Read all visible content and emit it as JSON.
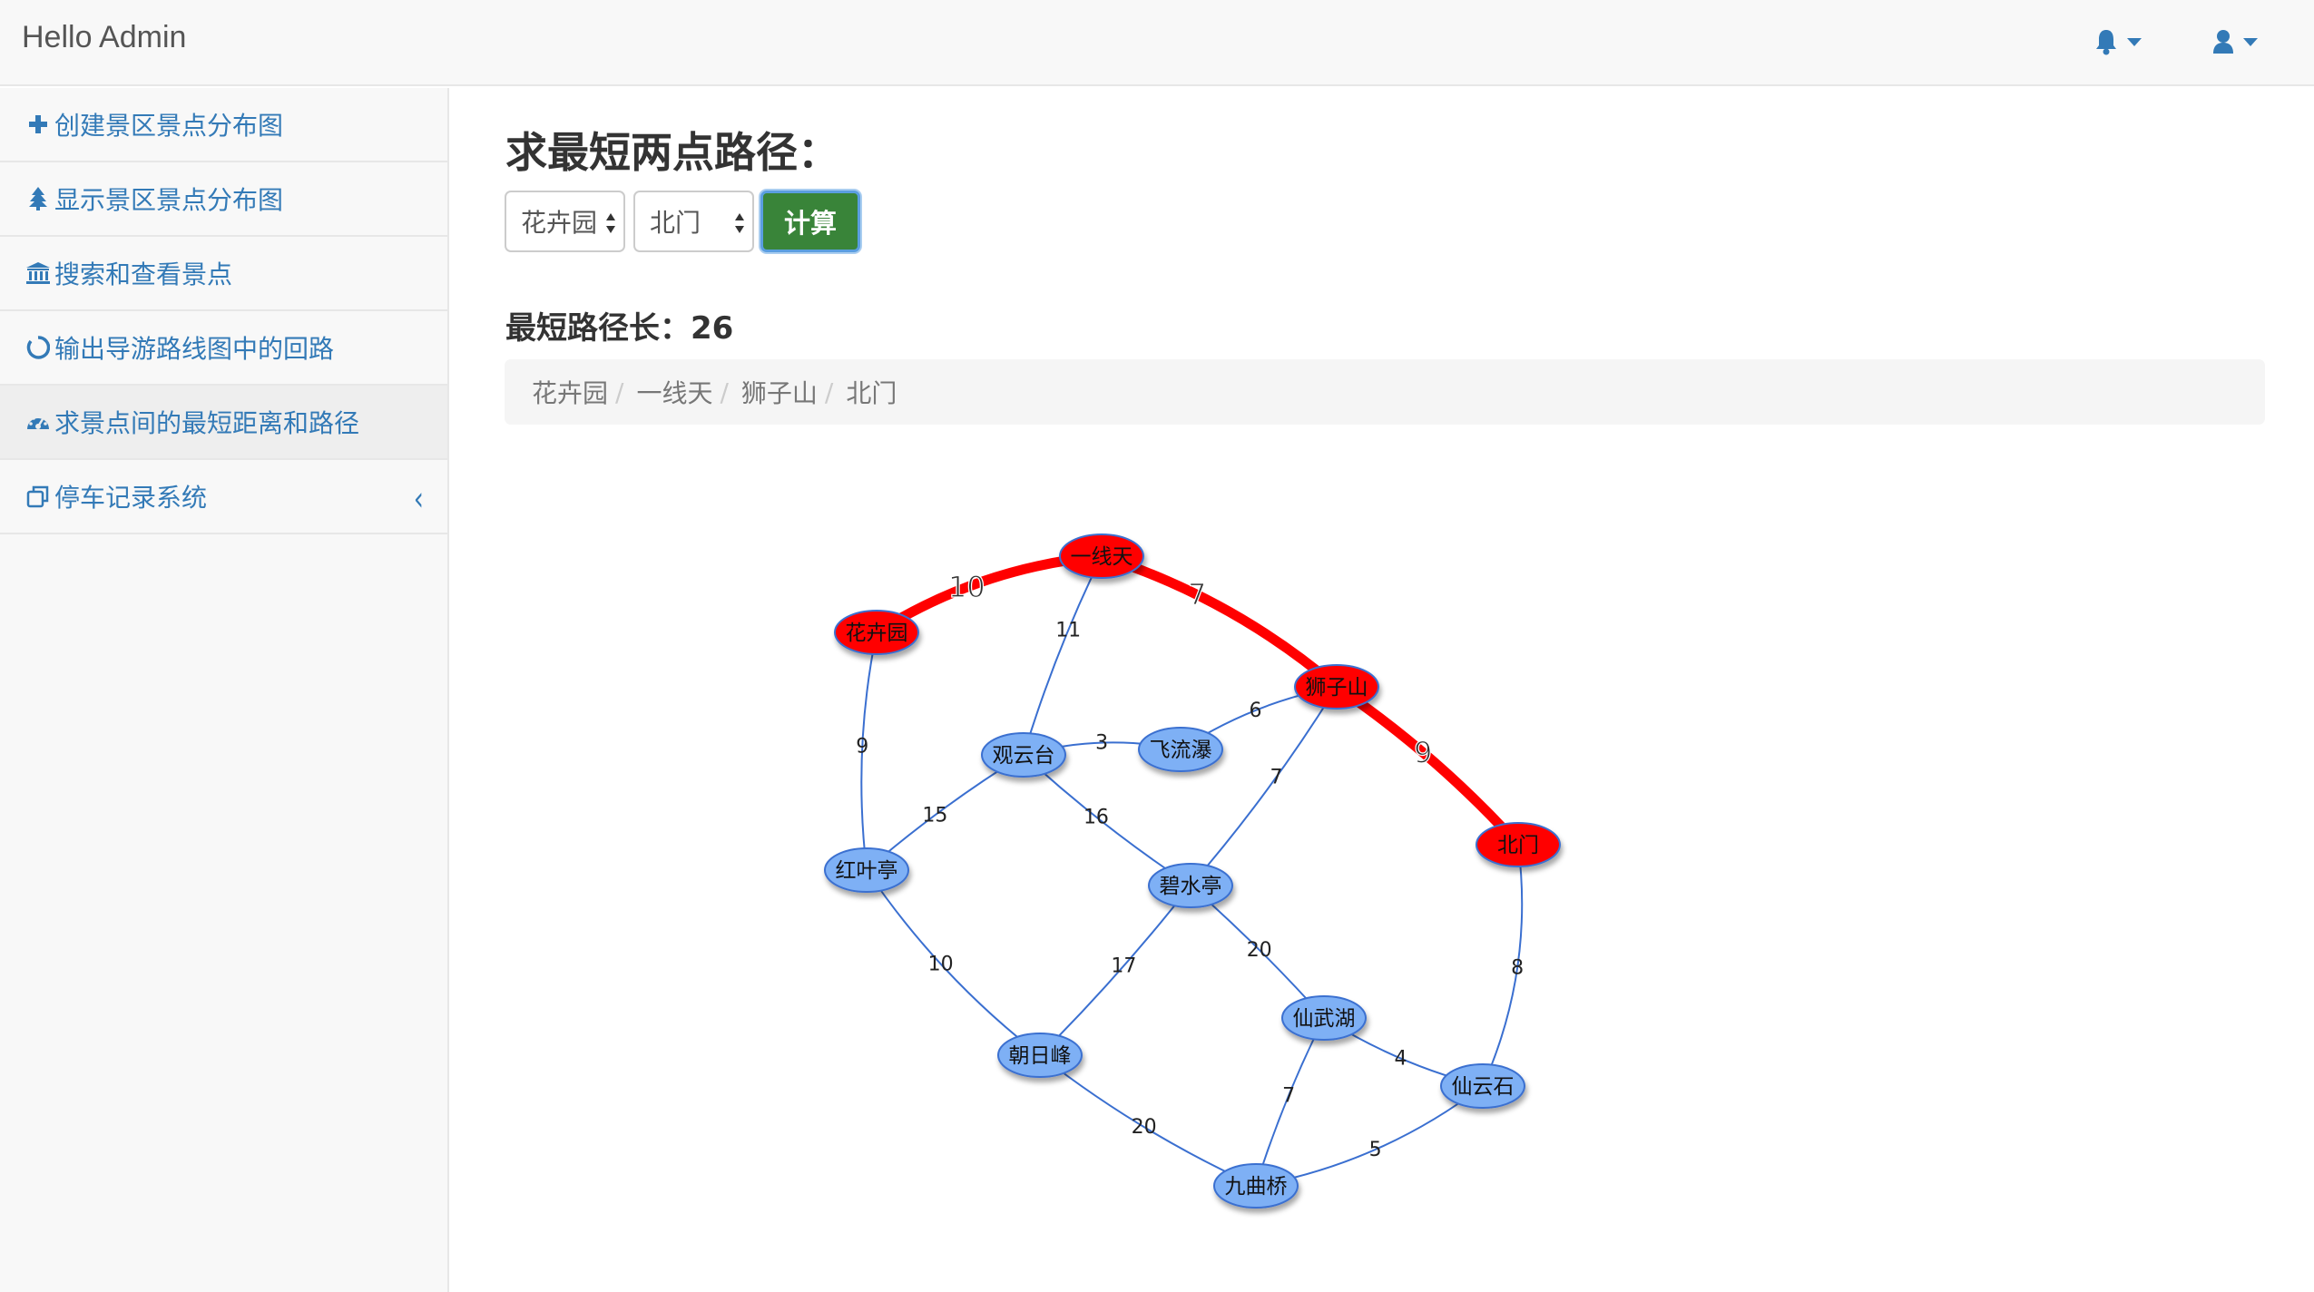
{
  "navbar": {
    "brand": "Hello Admin",
    "bell_icon": "bell-icon",
    "user_icon": "user-icon"
  },
  "sidebar": {
    "items": [
      {
        "label": "创建景区景点分布图",
        "icon": "plus-icon"
      },
      {
        "label": "显示景区景点分布图",
        "icon": "tree-icon"
      },
      {
        "label": "搜索和查看景点",
        "icon": "bank-icon"
      },
      {
        "label": "输出导游路线图中的回路",
        "icon": "circle-notch-icon"
      },
      {
        "label": "求景点间的最短距离和路径",
        "icon": "dashboard-icon",
        "active": true
      },
      {
        "label": "停车记录系统",
        "icon": "clone-icon",
        "expandable": true
      }
    ]
  },
  "main": {
    "title": "求最短两点路径：",
    "from_select": {
      "value": "花卉园"
    },
    "to_select": {
      "value": "北门"
    },
    "calc_button": "计算",
    "result_label": "最短路径长：26",
    "path": [
      "花卉园",
      "一线天",
      "狮子山",
      "北门"
    ]
  },
  "graph": {
    "colors": {
      "node_fill": "#7eb0f5",
      "node_stroke": "#3a6fd0",
      "highlight": "#ff0000",
      "edge": "#3a6fd0"
    },
    "nodes": [
      {
        "id": "一线天",
        "highlight": true
      },
      {
        "id": "花卉园",
        "highlight": true
      },
      {
        "id": "狮子山",
        "highlight": true
      },
      {
        "id": "观云台"
      },
      {
        "id": "飞流瀑"
      },
      {
        "id": "北门",
        "highlight": true
      },
      {
        "id": "红叶亭"
      },
      {
        "id": "碧水亭"
      },
      {
        "id": "仙武湖"
      },
      {
        "id": "朝日峰"
      },
      {
        "id": "仙云石"
      },
      {
        "id": "九曲桥"
      }
    ],
    "edges": [
      {
        "from": "花卉园",
        "to": "一线天",
        "weight": "10",
        "highlight": true
      },
      {
        "from": "一线天",
        "to": "狮子山",
        "weight": "7",
        "highlight": true
      },
      {
        "from": "狮子山",
        "to": "北门",
        "weight": "9",
        "highlight": true
      },
      {
        "from": "一线天",
        "to": "观云台",
        "weight": "11"
      },
      {
        "from": "花卉园",
        "to": "红叶亭",
        "weight": "9"
      },
      {
        "from": "观云台",
        "to": "飞流瀑",
        "weight": "3"
      },
      {
        "from": "飞流瀑",
        "to": "狮子山",
        "weight": "6"
      },
      {
        "from": "观云台",
        "to": "红叶亭",
        "weight": "15"
      },
      {
        "from": "观云台",
        "to": "碧水亭",
        "weight": "16"
      },
      {
        "from": "狮子山",
        "to": "碧水亭",
        "weight": "7"
      },
      {
        "from": "北门",
        "to": "仙云石",
        "weight": "8"
      },
      {
        "from": "红叶亭",
        "to": "朝日峰",
        "weight": "10"
      },
      {
        "from": "碧水亭",
        "to": "朝日峰",
        "weight": "17"
      },
      {
        "from": "碧水亭",
        "to": "仙武湖",
        "weight": "20"
      },
      {
        "from": "仙武湖",
        "to": "仙云石",
        "weight": "4"
      },
      {
        "from": "仙武湖",
        "to": "九曲桥",
        "weight": "7"
      },
      {
        "from": "朝日峰",
        "to": "九曲桥",
        "weight": "20"
      },
      {
        "from": "九曲桥",
        "to": "仙云石",
        "weight": "5"
      }
    ]
  }
}
